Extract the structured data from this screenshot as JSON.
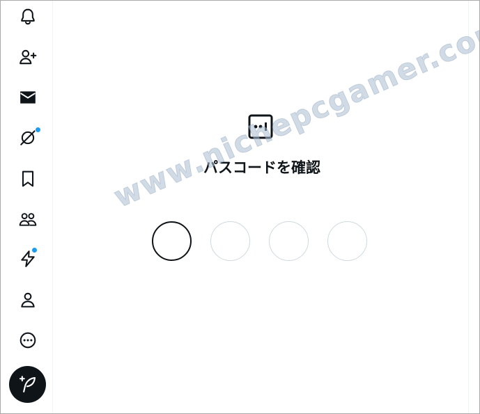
{
  "sidebar": {
    "items": [
      {
        "icon": "bell-icon",
        "label": "Notifications"
      },
      {
        "icon": "follow-user-icon",
        "label": "Follow"
      },
      {
        "icon": "mail-icon",
        "label": "Messages"
      },
      {
        "icon": "grok-icon",
        "label": "Grok",
        "badge": true
      },
      {
        "icon": "bookmark-icon",
        "label": "Bookmarks"
      },
      {
        "icon": "communities-icon",
        "label": "Communities"
      },
      {
        "icon": "premium-lightning-icon",
        "label": "Premium",
        "badge": true
      },
      {
        "icon": "profile-icon",
        "label": "Profile"
      },
      {
        "icon": "more-icon",
        "label": "More"
      }
    ],
    "compose_icon": "compose-post-icon"
  },
  "main": {
    "icon": "passcode-icon",
    "title": "パスコードを確認",
    "pin_count": 4,
    "active_pin_index": 0
  },
  "watermark": {
    "text": "www.nichepcgamer.com"
  },
  "colors": {
    "accent": "#1d9bf0",
    "text": "#0f1419",
    "pin_border": "#cfd9de"
  }
}
